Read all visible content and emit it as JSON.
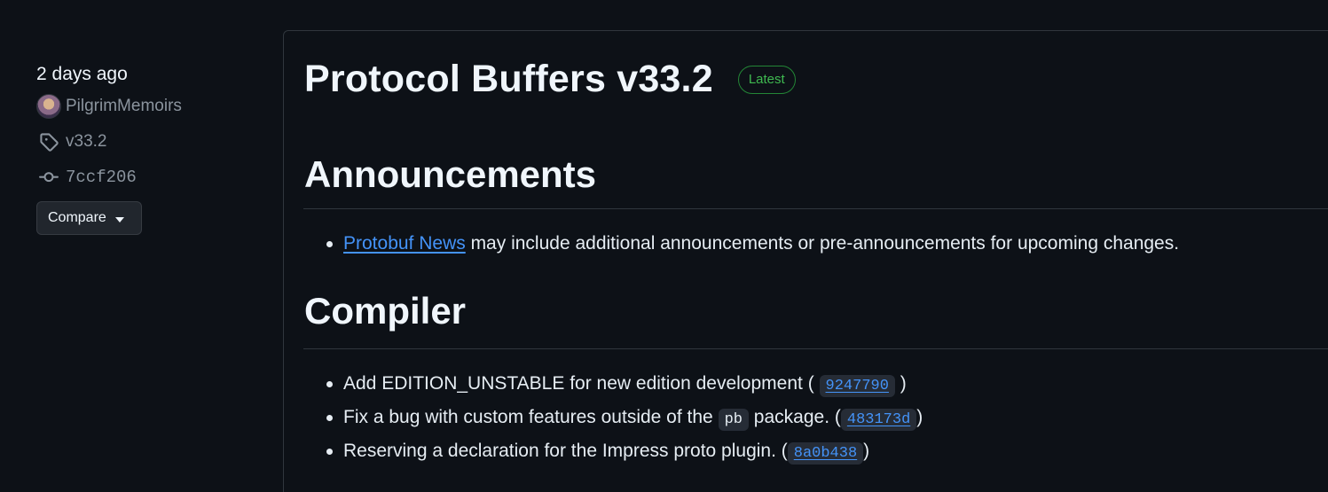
{
  "sidebar": {
    "date": "2 days ago",
    "author": "PilgrimMemoirs",
    "tag": "v33.2",
    "commit": "7ccf206",
    "compare_label": "Compare"
  },
  "release": {
    "title": "Protocol Buffers v33.2",
    "badge": "Latest",
    "sections": {
      "announcements": {
        "heading": "Announcements",
        "item_link": "Protobuf News",
        "item_text": " may include additional announcements or pre-announcements for upcoming changes."
      },
      "compiler": {
        "heading": "Compiler",
        "items": [
          {
            "text": "Add EDITION_UNSTABLE for new edition development (",
            "commit": "9247790",
            "close": ")"
          },
          {
            "text_before": "Fix a bug with custom features outside of the ",
            "code": "pb",
            "text_after": " package. (",
            "commit": "483173d",
            "close": ")"
          },
          {
            "text": "Reserving a declaration for the Impress proto plugin. (",
            "commit": "8a0b438",
            "close": ")"
          }
        ]
      }
    }
  },
  "colors": {
    "background": "#0d1117",
    "link": "#4493f8",
    "badge_green": "#3fb950",
    "border": "#30363d"
  },
  "icons": [
    "avatar",
    "tag-icon",
    "commit-icon",
    "caret-down-icon"
  ]
}
